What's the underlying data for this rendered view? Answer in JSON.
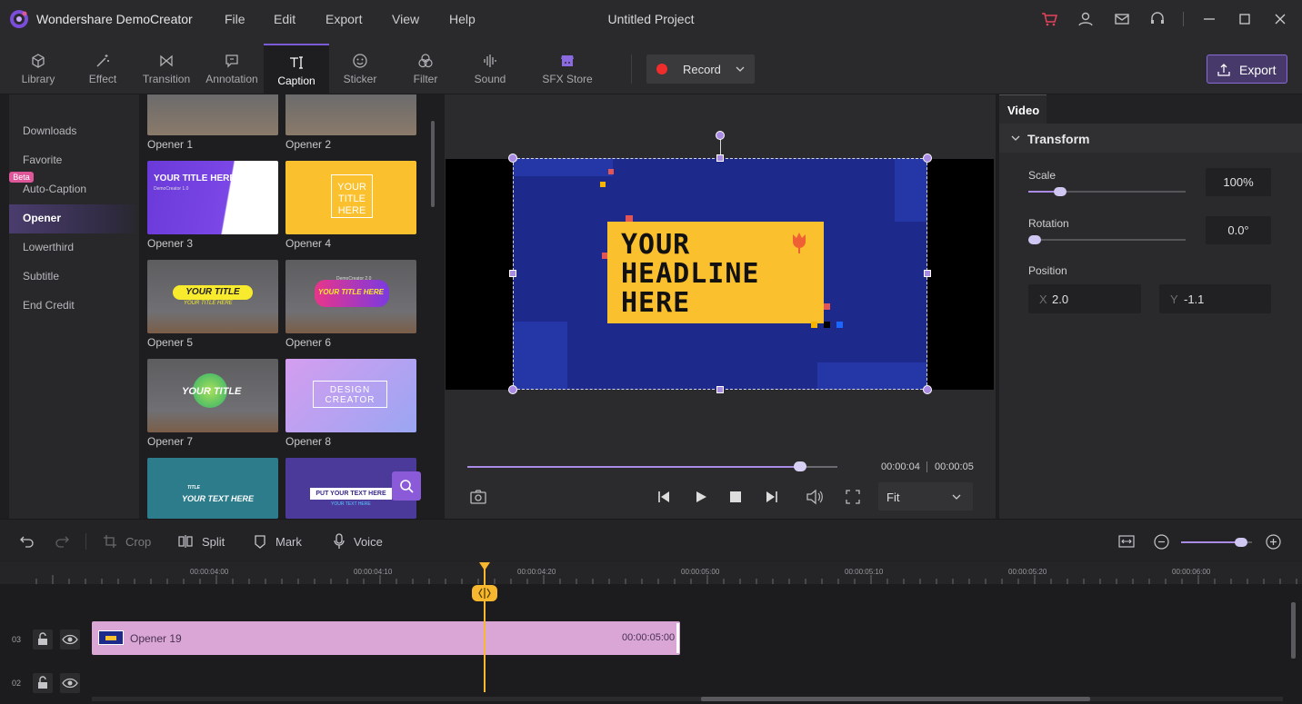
{
  "app": {
    "name": "Wondershare DemoCreator",
    "project_title": "Untitled Project",
    "menu": [
      "File",
      "Edit",
      "Export",
      "View",
      "Help"
    ],
    "title_icons": [
      "cart-icon",
      "user-icon",
      "mail-icon",
      "headset-icon",
      "minimize-icon",
      "maximize-icon",
      "close-icon"
    ],
    "accent_color": "#7c5cd6"
  },
  "toolbar": {
    "tools": [
      {
        "label": "Library",
        "icon": "cube-icon"
      },
      {
        "label": "Effect",
        "icon": "magic-wand-icon"
      },
      {
        "label": "Transition",
        "icon": "bowtie-icon"
      },
      {
        "label": "Annotation",
        "icon": "speech-bubble-icon"
      },
      {
        "label": "Caption",
        "icon": "text-cursor-icon",
        "active": true
      },
      {
        "label": "Sticker",
        "icon": "smiley-icon"
      },
      {
        "label": "Filter",
        "icon": "circles-icon"
      },
      {
        "label": "Sound",
        "icon": "waveform-icon"
      },
      {
        "label": "SFX Store",
        "icon": "store-icon"
      }
    ],
    "record_label": "Record",
    "export_label": "Export"
  },
  "sidebar": {
    "items": [
      {
        "label": "Downloads"
      },
      {
        "label": "Favorite"
      },
      {
        "label": "Auto-Caption",
        "badge": "Beta"
      },
      {
        "label": "Opener",
        "active": true
      },
      {
        "label": "Lowerthird"
      },
      {
        "label": "Subtitle"
      },
      {
        "label": "End Credit"
      }
    ]
  },
  "gallery": {
    "items": [
      {
        "label": "Opener 1"
      },
      {
        "label": "Opener 2"
      },
      {
        "label": "Opener 3",
        "text": "YOUR TITLE HERE",
        "sub": "DemoCreator 1.0"
      },
      {
        "label": "Opener 4",
        "text": "YOUR TITLE HERE"
      },
      {
        "label": "Opener 5",
        "text": "YOUR TITLE",
        "sub": "YOUR TITLE HERE"
      },
      {
        "label": "Opener 6",
        "text": "YOUR TITLE HERE",
        "sub": "DemoCreator 2.0"
      },
      {
        "label": "Opener 7",
        "text": "YOUR TITLE"
      },
      {
        "label": "Opener 8",
        "text": "DESIGN CREATOR"
      },
      {
        "label": "",
        "text": "YOUR TEXT HERE",
        "sub": "TITLE"
      },
      {
        "label": "",
        "text": "PUT YOUR TEXT HERE",
        "sub": "YOUR TEXT HERE"
      }
    ]
  },
  "preview": {
    "headline": [
      "YOUR",
      "HEADLINE",
      "HERE"
    ],
    "time_current": "00:00:04",
    "time_total": "00:00:05",
    "progress": 0.9,
    "fit_option": "Fit"
  },
  "properties": {
    "tab": "Video",
    "section": "Transform",
    "scale_label": "Scale",
    "scale_value": "100%",
    "scale_fraction": 0.2,
    "rotation_label": "Rotation",
    "rotation_value": "0.0°",
    "rotation_fraction": 0.0,
    "position_label": "Position",
    "pos_x_label": "X",
    "pos_x": "2.0",
    "pos_y_label": "Y",
    "pos_y": "-1.1"
  },
  "edit_toolbar": {
    "crop": "Crop",
    "split": "Split",
    "mark": "Mark",
    "voice": "Voice",
    "zoom_fraction": 0.85
  },
  "timeline": {
    "ticks": [
      "00:00:04:00",
      "00:00:04:10",
      "00:00:04:20",
      "00:00:05:00",
      "00:00:05:10",
      "00:00:05:20",
      "00:00:06:00"
    ],
    "tracks": [
      {
        "num": "03",
        "clip_name": "Opener 19",
        "clip_duration": "00:00:05:00"
      },
      {
        "num": "02"
      }
    ]
  }
}
